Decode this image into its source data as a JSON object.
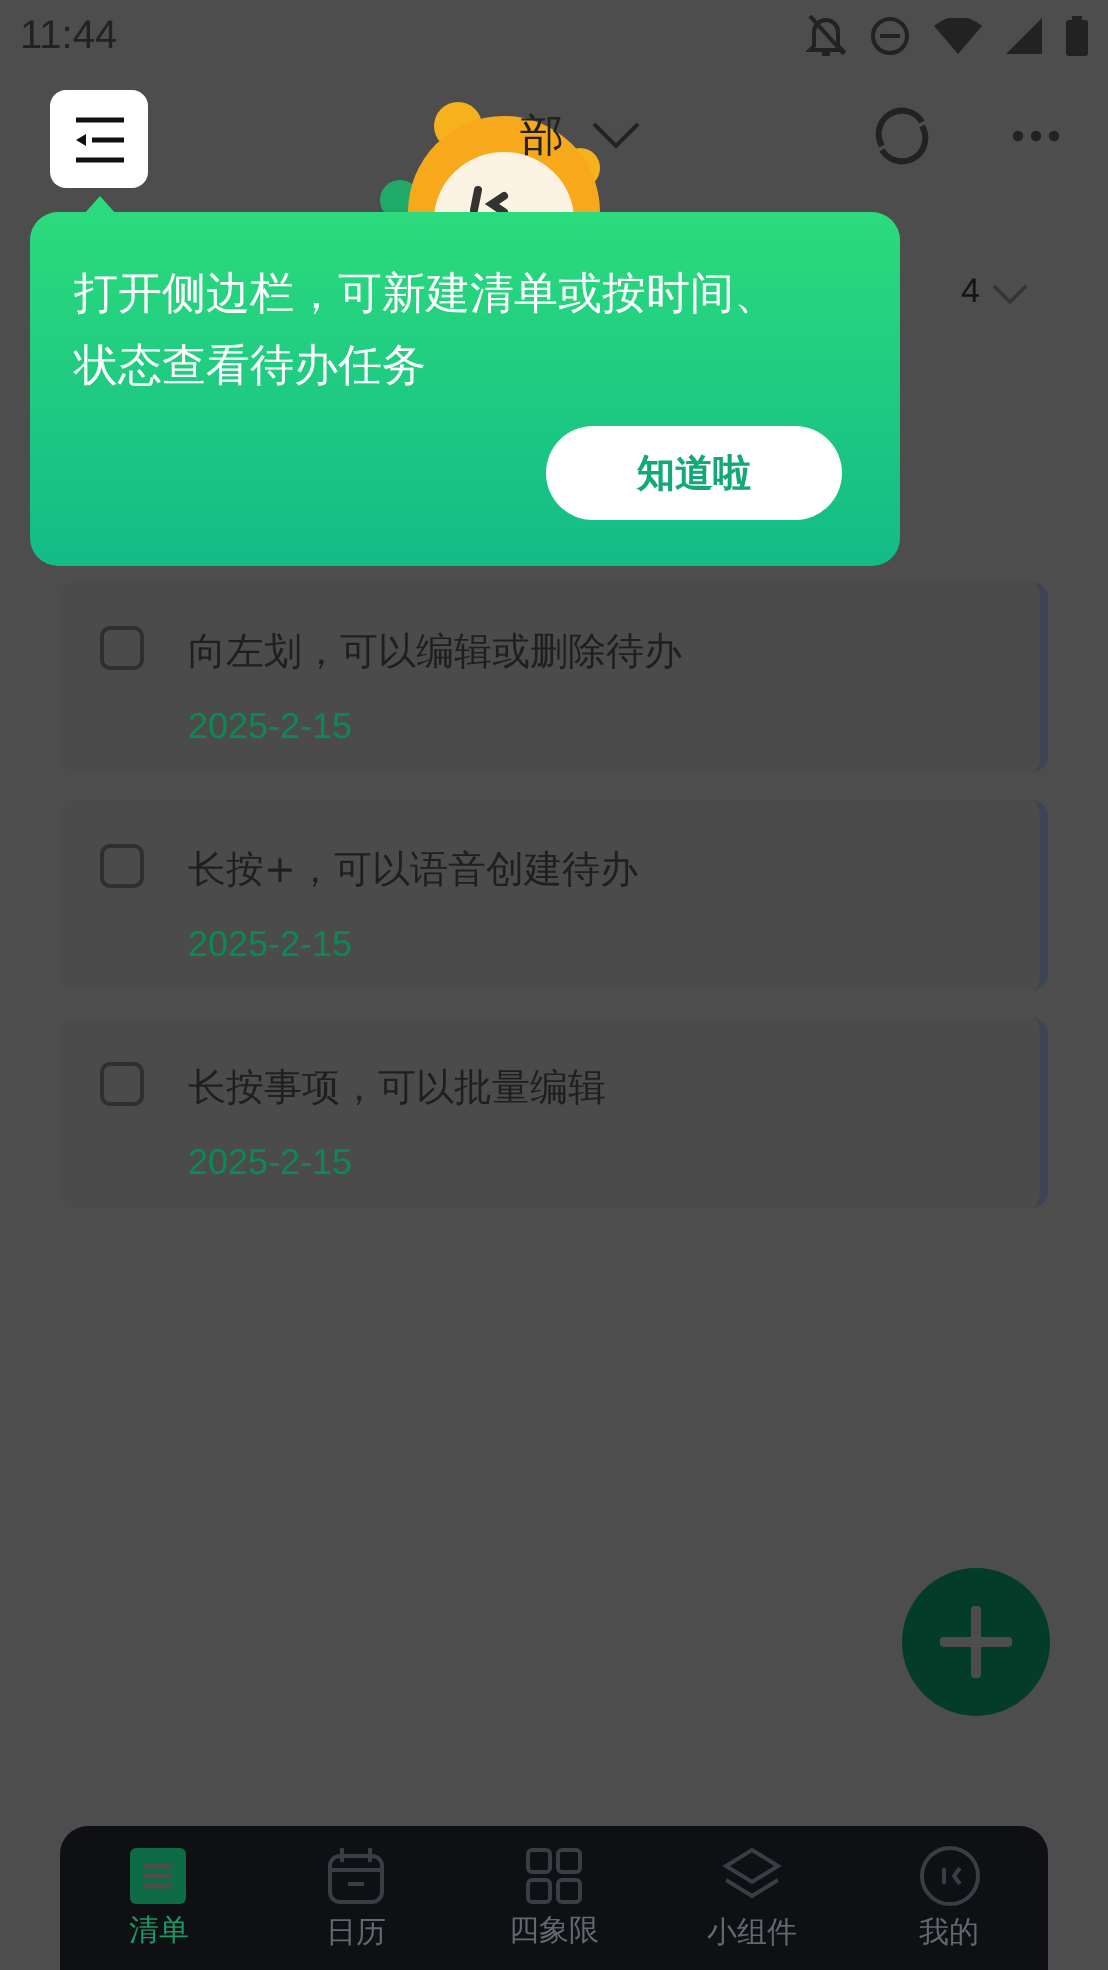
{
  "status_bar": {
    "time": "11:44"
  },
  "header": {
    "title": "部"
  },
  "list_header": {
    "count": "4"
  },
  "tasks": [
    {
      "title": "向左划，可以编辑或删除待办",
      "date": "2025-2-15",
      "checked": false
    },
    {
      "title": "长按+，可以语音创建待办",
      "date": "2025-2-15",
      "checked": false
    },
    {
      "title": "长按事项，可以批量编辑",
      "date": "2025-2-15",
      "checked": false
    }
  ],
  "tooltip": {
    "text": "打开侧边栏，可新建清单或按时间、状态查看待办任务",
    "button": "知道啦"
  },
  "tabs": [
    {
      "label": "清单",
      "kind": "list",
      "selected": true
    },
    {
      "label": "日历",
      "kind": "calendar",
      "selected": false
    },
    {
      "label": "四象限",
      "kind": "grid",
      "selected": false
    },
    {
      "label": "小组件",
      "kind": "layers",
      "selected": false
    },
    {
      "label": "我的",
      "kind": "profile",
      "selected": false
    }
  ]
}
